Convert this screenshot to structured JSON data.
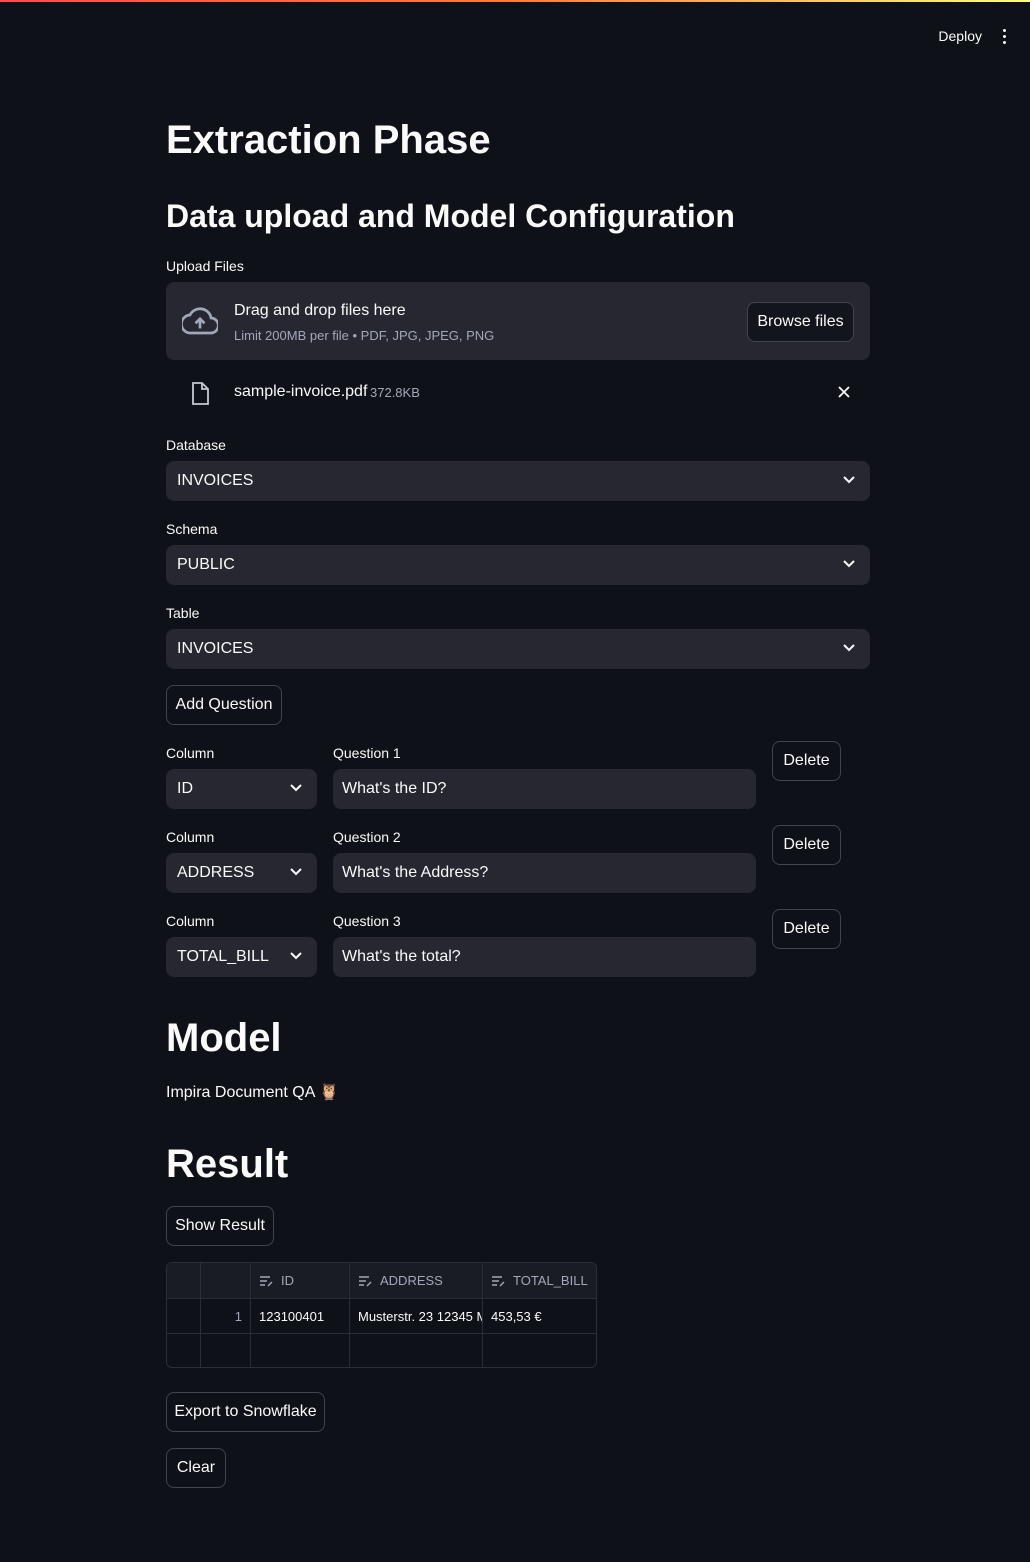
{
  "header": {
    "deploy_label": "Deploy"
  },
  "page": {
    "title": "Extraction Phase",
    "subtitle": "Data upload and Model Configuration"
  },
  "upload": {
    "label": "Upload Files",
    "drag_title": "Drag and drop files here",
    "drag_sub": "Limit 200MB per file • PDF, JPG, JPEG, PNG",
    "browse_label": "Browse files",
    "file": {
      "name": "sample-invoice.pdf",
      "size": "372.8KB"
    }
  },
  "database": {
    "label": "Database",
    "value": "INVOICES"
  },
  "schema": {
    "label": "Schema",
    "value": "PUBLIC"
  },
  "table": {
    "label": "Table",
    "value": "INVOICES"
  },
  "add_question_label": "Add Question",
  "questions": [
    {
      "column_label": "Column",
      "column_value": "ID",
      "question_label": "Question 1",
      "question_value": "What's the ID?",
      "delete_label": "Delete"
    },
    {
      "column_label": "Column",
      "column_value": "ADDRESS",
      "question_label": "Question 2",
      "question_value": "What's the Address?",
      "delete_label": "Delete"
    },
    {
      "column_label": "Column",
      "column_value": "TOTAL_BILL",
      "question_label": "Question 3",
      "question_value": "What's the total?",
      "delete_label": "Delete"
    }
  ],
  "model": {
    "heading": "Model",
    "text": "Impira Document QA 🦉"
  },
  "result": {
    "heading": "Result",
    "show_label": "Show Result",
    "columns": [
      "ID",
      "ADDRESS",
      "TOTAL_BILL"
    ],
    "rows": [
      {
        "index": "1",
        "ID": "123100401",
        "ADDRESS": "Musterstr. 23 12345 M",
        "TOTAL_BILL": "453,53 €"
      }
    ]
  },
  "export_label": "Export to Snowflake",
  "clear_label": "Clear"
}
